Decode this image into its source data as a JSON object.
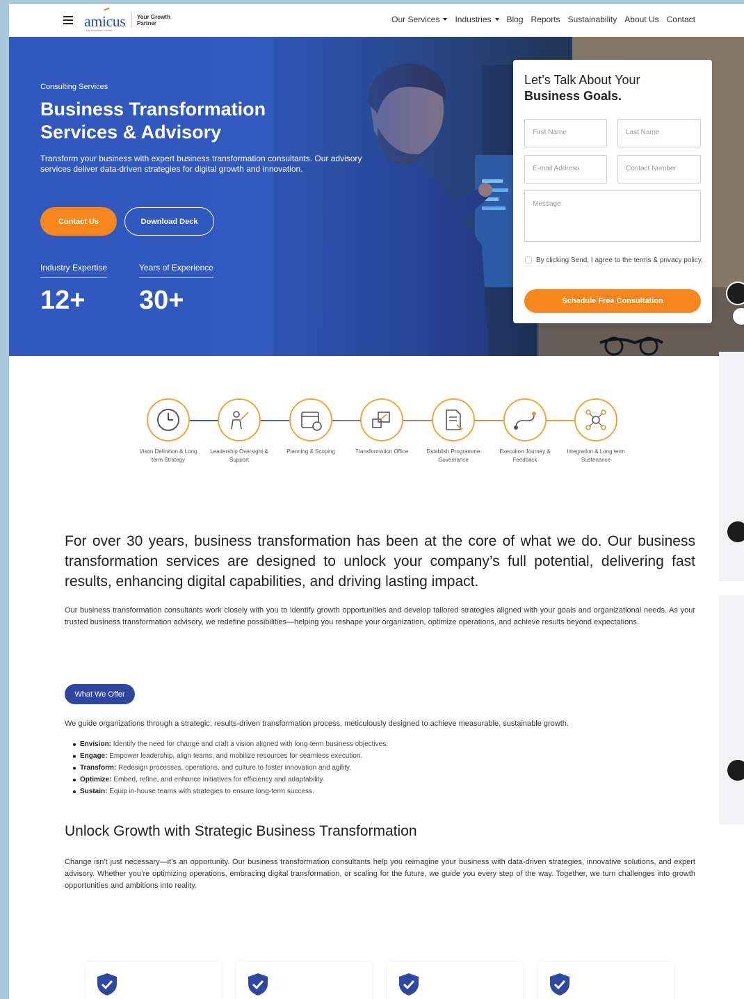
{
  "header": {
    "logo_text": "amicus",
    "logo_tag": "The Business Partner",
    "tagline": "Your Growth Partner",
    "nav": [
      {
        "label": "Our Services",
        "dropdown": true
      },
      {
        "label": "Industries",
        "dropdown": true
      },
      {
        "label": "Blog",
        "dropdown": false
      },
      {
        "label": "Reports",
        "dropdown": false
      },
      {
        "label": "Sustainability",
        "dropdown": false
      },
      {
        "label": "About Us",
        "dropdown": false
      },
      {
        "label": "Contact",
        "dropdown": false
      }
    ]
  },
  "hero": {
    "kicker": "Consulting Services",
    "title": "Business Transformation Services & Advisory",
    "description": "Transform your business with expert business transformation consultants. Our advisory services deliver data-driven strategies for digital growth and innovation.",
    "contact_button": "Contact Us",
    "deck_button": "Download Deck",
    "stats": [
      {
        "label": "Industry Expertise",
        "value": "12+"
      },
      {
        "label": "Years of Experience",
        "value": "30+"
      }
    ]
  },
  "form": {
    "title_line1": "Let’s Talk About Your",
    "title_line2": "Business Goals.",
    "first_name_placeholder": "First Name",
    "last_name_placeholder": "Last Name",
    "email_placeholder": "E-mail Address",
    "contact_placeholder": "Contact Number",
    "message_placeholder": "Message",
    "agree_text": "By clicking Send, I agree to the terms & privacy policy.",
    "submit_label": "Schedule Free Consultation"
  },
  "process": [
    {
      "label": "Vison Definition & Long term Strategy",
      "icon": "clock-icon"
    },
    {
      "label": "Leadership Oversight & Support",
      "icon": "leader-icon"
    },
    {
      "label": "Planning & Scoping",
      "icon": "calendar-icon"
    },
    {
      "label": "Transformation Office",
      "icon": "office-icon"
    },
    {
      "label": "Establish Programme Governance",
      "icon": "document-icon"
    },
    {
      "label": "Execution Journey & Feedback",
      "icon": "journey-icon"
    },
    {
      "label": "Integration & Long term Sustenance",
      "icon": "network-icon"
    }
  ],
  "intro": {
    "lead": "For over 30 years, business transformation has been at the core of what we do. Our business transformation services are designed to unlock your company’s full potential, delivering fast results, enhancing digital capabilities, and driving lasting impact.",
    "body": "Our business transformation consultants work closely with you to identify growth opportunities and develop tailored strategies aligned with your goals and organizational needs. As your trusted business transformation advisory, we redefine possibilities—helping you reshape your organization, optimize operations, and achieve results beyond expectations."
  },
  "offer": {
    "pill": "What We Offer",
    "intro": "We guide organizations through a strategic, results-driven transformation process, meticulously designed to achieve measurable, sustainable growth.",
    "items": [
      {
        "term": "Envision:",
        "text": "Identify the need for change and craft a vision aligned with long-term business objectives."
      },
      {
        "term": "Engage:",
        "text": "Empower leadership, align teams, and mobilize resources for seamless execution."
      },
      {
        "term": "Transform:",
        "text": "Redesign processes, operations, and culture to foster innovation and agility."
      },
      {
        "term": "Optimize:",
        "text": "Embed, refine, and enhance initiatives for efficiency and adaptability."
      },
      {
        "term": "Sustain:",
        "text": "Equip in-house teams with strategies to ensure long-term success."
      }
    ]
  },
  "growth": {
    "heading": "Unlock Growth with Strategic Business Transformation",
    "text": "Change isn’t just necessary—it’s an opportunity. Our business transformation consultants help you reimagine your business with data-driven strategies, innovative solutions, and expert advisory. Whether you’re optimizing operations, embracing digital transformation, or scaling for the future, we guide you every step of the way. Together, we turn challenges into growth opportunities and ambitions into reality."
  },
  "colors": {
    "primary_blue": "#2f56b5",
    "accent_orange": "#f7861d",
    "pill_blue": "#2f46a3"
  }
}
